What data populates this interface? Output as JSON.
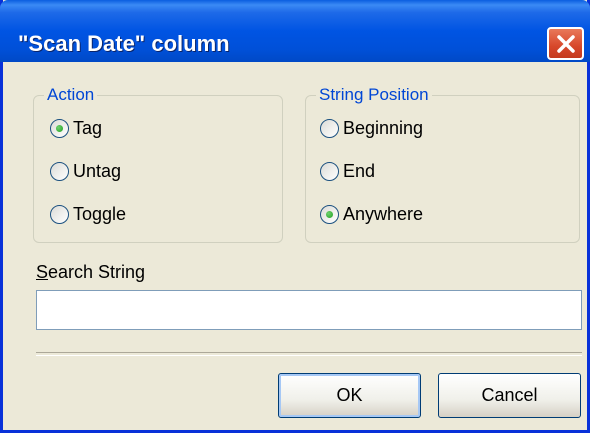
{
  "window": {
    "title": "\"Scan Date\" column"
  },
  "action_group": {
    "legend": "Action",
    "options": [
      {
        "label": "Tag",
        "checked": true
      },
      {
        "label": "Untag",
        "checked": false
      },
      {
        "label": "Toggle",
        "checked": false
      }
    ]
  },
  "position_group": {
    "legend": "String Position",
    "options": [
      {
        "label": "Beginning",
        "checked": false
      },
      {
        "label": "End",
        "checked": false
      },
      {
        "label": "Anywhere",
        "checked": true
      }
    ]
  },
  "search": {
    "label_first": "S",
    "label_rest": "earch String",
    "value": ""
  },
  "buttons": {
    "ok": "OK",
    "cancel": "Cancel"
  }
}
